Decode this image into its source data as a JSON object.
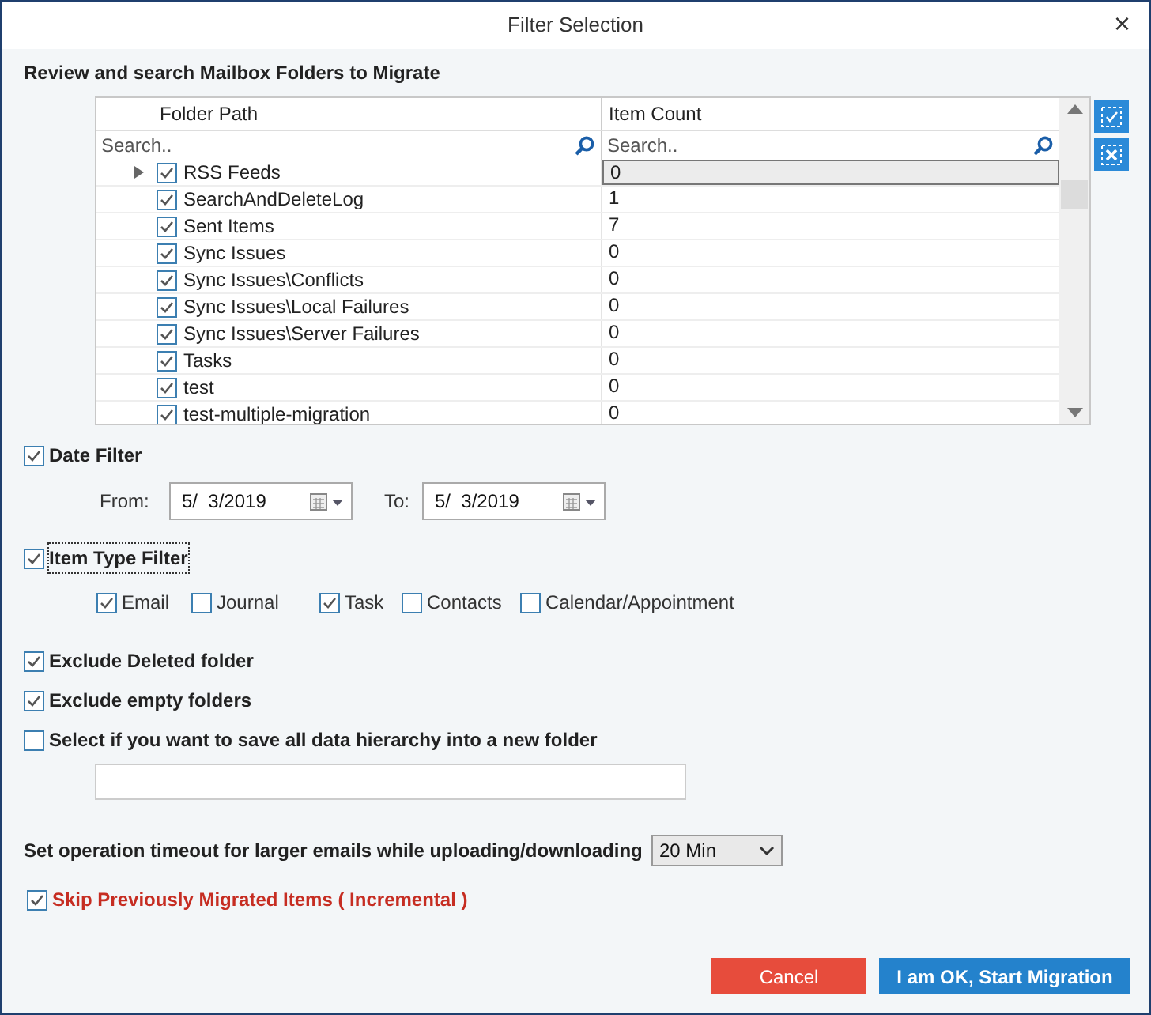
{
  "window": {
    "title": "Filter Selection",
    "close": "×"
  },
  "heading": "Review and search Mailbox Folders to Migrate",
  "grid": {
    "columns": [
      "Folder Path",
      "Item Count"
    ],
    "search_placeholders": [
      "Search..",
      "Search.."
    ],
    "rows": [
      {
        "path": "RSS Feeds",
        "count": "0",
        "checked": true,
        "expandable": true,
        "selected": true
      },
      {
        "path": "SearchAndDeleteLog",
        "count": "1",
        "checked": true,
        "expandable": false,
        "selected": false
      },
      {
        "path": "Sent Items",
        "count": "7",
        "checked": true,
        "expandable": false,
        "selected": false
      },
      {
        "path": "Sync Issues",
        "count": "0",
        "checked": true,
        "expandable": false,
        "selected": false
      },
      {
        "path": "Sync Issues\\Conflicts",
        "count": "0",
        "checked": true,
        "expandable": false,
        "selected": false
      },
      {
        "path": "Sync Issues\\Local Failures",
        "count": "0",
        "checked": true,
        "expandable": false,
        "selected": false
      },
      {
        "path": "Sync Issues\\Server Failures",
        "count": "0",
        "checked": true,
        "expandable": false,
        "selected": false
      },
      {
        "path": "Tasks",
        "count": "0",
        "checked": true,
        "expandable": false,
        "selected": false
      },
      {
        "path": "test",
        "count": "0",
        "checked": true,
        "expandable": false,
        "selected": false
      },
      {
        "path": "test-multiple-migration",
        "count": "0",
        "checked": true,
        "expandable": false,
        "selected": false
      }
    ]
  },
  "date_filter": {
    "label": "Date Filter",
    "checked": true,
    "from_label": "From:",
    "from": "5/  3/2019",
    "to_label": "To:",
    "to": "5/  3/2019"
  },
  "item_type_filter": {
    "label": "Item Type Filter",
    "checked": true,
    "types": [
      {
        "label": "Email",
        "checked": true
      },
      {
        "label": "Journal",
        "checked": false
      },
      {
        "label": "Task",
        "checked": true
      },
      {
        "label": "Contacts",
        "checked": false
      },
      {
        "label": "Calendar/Appointment",
        "checked": false
      }
    ]
  },
  "options": [
    {
      "label": "Exclude Deleted folder",
      "checked": true
    },
    {
      "label": "Exclude empty folders",
      "checked": true
    },
    {
      "label": "Select if you want to save all data hierarchy into a new folder",
      "checked": false
    }
  ],
  "timeout": {
    "label": "Set operation timeout for larger emails while uploading/downloading",
    "value": "20 Min"
  },
  "skip": {
    "label": "Skip Previously Migrated Items ( Incremental )",
    "checked": true
  },
  "buttons": [
    "Cancel",
    "I am OK, Start Migration"
  ]
}
